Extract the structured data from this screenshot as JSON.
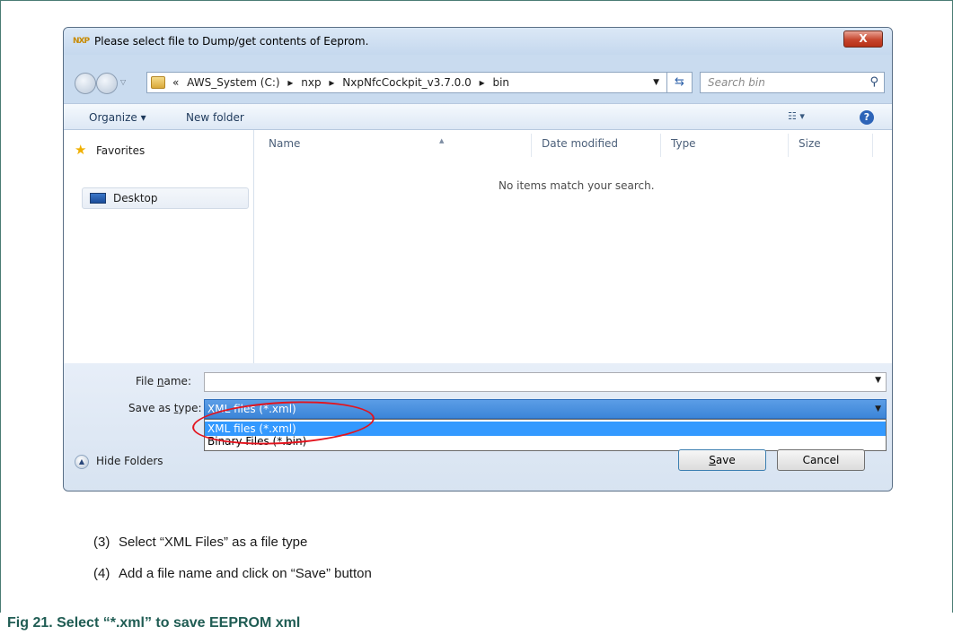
{
  "dialog": {
    "title": "Please select file to Dump/get contents of Eeprom.",
    "logo_text": "NXP",
    "close_label": "X",
    "address_crumbs": [
      "«",
      "AWS_System (C:)",
      "▸",
      "nxp",
      "▸",
      "NxpNfcCockpit_v3.7.0.0",
      "▸",
      "bin"
    ],
    "search_placeholder": "Search bin",
    "toolbar": {
      "organize_label": "Organize ▾",
      "new_folder_label": "New folder",
      "help_label": "?"
    },
    "nav_pane": {
      "favorites_label": "Favorites",
      "desktop_label": "Desktop"
    },
    "columns": [
      "Name",
      "Date modified",
      "Type",
      "Size"
    ],
    "empty_message": "No items match your search.",
    "file_name_label_prefix": "File ",
    "file_name_label_accel": "n",
    "file_name_label_suffix": "ame:",
    "file_name_value": "",
    "save_type_label_prefix": "Save as ",
    "save_type_label_accel": "t",
    "save_type_label_suffix": "ype:",
    "save_type_selected": "XML files (*.xml)",
    "save_type_options": [
      "XML files (*.xml)",
      "Binary Files (*.bin)"
    ],
    "hide_folders_label": "Hide Folders",
    "save_button_accel": "S",
    "save_button_suffix": "ave",
    "cancel_button_label": "Cancel"
  },
  "steps": [
    {
      "num": "(3)",
      "text": "Select “XML Files” as a file type"
    },
    {
      "num": "(4)",
      "text": "Add a file name and click on “Save” button"
    }
  ],
  "figure_caption": "Fig 21.   Select “*.xml” to save EEPROM xml",
  "colors": {
    "highlight": "#3399ff",
    "annotation": "#e3141e",
    "caption": "#1f5c53"
  }
}
